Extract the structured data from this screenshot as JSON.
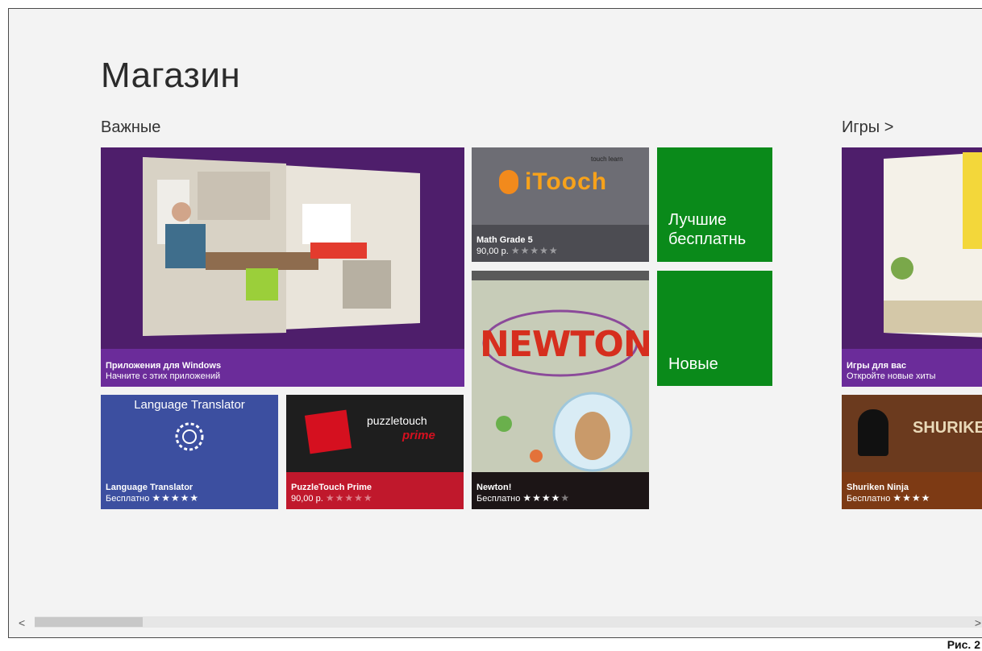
{
  "app": {
    "title": "Магазин"
  },
  "sections": {
    "featured": "Важные",
    "games": "Игры >"
  },
  "tiles": {
    "windows_apps": {
      "title": "Приложения для Windows",
      "subtitle": "Начните с этих приложений"
    },
    "math": {
      "title": "Math Grade 5",
      "price": "90,00 р.",
      "stars": "★★★★★",
      "logo_text": "iTooch",
      "logo_sub": "touch learn"
    },
    "best_free": {
      "label_line1": "Лучшие",
      "label_line2": "бесплатнь"
    },
    "new_apps": {
      "label": "Новые"
    },
    "newton": {
      "title": "Newton!",
      "price": "Бесплатно",
      "stars_full": "★★★★",
      "stars_empty": "★",
      "art_text": "NEWTON"
    },
    "language": {
      "header": "Language Translator",
      "title": "Language Translator",
      "price": "Бесплатно",
      "stars": "★★★★★"
    },
    "puzzle": {
      "title": "PuzzleTouch Prime",
      "price": "90,00 р.",
      "stars": "★★★★★",
      "logo_line1": "puzzletouch",
      "logo_line2": "prime"
    },
    "games_for_you": {
      "title": "Игры для вас",
      "subtitle": "Откройте новые хиты"
    },
    "shuriken": {
      "title": "Shuriken Ninja",
      "price": "Бесплатно",
      "stars": "★★★★",
      "art_text": "SHURIKE"
    }
  },
  "scrollbar": {
    "left": "<",
    "right": ">"
  },
  "caption": "Рис. 2",
  "colors": {
    "purple": "#4e1e6b",
    "purple_label": "#6b2c9a",
    "green": "#0a8a1a",
    "blue": "#3c4fa0",
    "dark": "#1e1e1e",
    "red": "#c0182c",
    "gray": "#6d6d74",
    "brown": "#6b3a1e"
  }
}
